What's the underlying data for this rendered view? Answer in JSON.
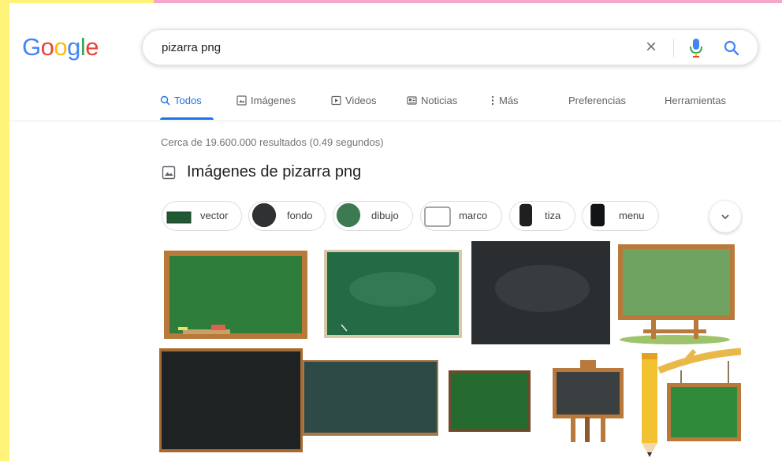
{
  "logo": {
    "letters": [
      "G",
      "o",
      "o",
      "g",
      "l",
      "e"
    ],
    "colors": [
      "#4285f4",
      "#ea4335",
      "#fbbc05",
      "#4285f4",
      "#34a853",
      "#ea4335"
    ]
  },
  "search": {
    "query": "pizarra png",
    "clear_glyph": "×"
  },
  "tabs": [
    {
      "label": "Todos",
      "icon": "search-icon"
    },
    {
      "label": "Imágenes",
      "icon": "image-icon"
    },
    {
      "label": "Videos",
      "icon": "video-icon"
    },
    {
      "label": "Noticias",
      "icon": "news-icon"
    },
    {
      "label": "Más",
      "icon": "more-vertical-icon"
    },
    {
      "label": "Preferencias"
    },
    {
      "label": "Herramientas"
    }
  ],
  "result_stats": "Cerca de 19.600.000 resultados (0.49 segundos)",
  "images_heading": "Imágenes de pizarra png",
  "chips": [
    {
      "label": "vector"
    },
    {
      "label": "fondo"
    },
    {
      "label": "dibujo"
    },
    {
      "label": "marco"
    },
    {
      "label": "tiza"
    },
    {
      "label": "menu"
    }
  ],
  "colors": {
    "accent": "#1a73e8",
    "board_green": "#2f7d3a",
    "board_black": "#2b2e31",
    "wood": "#b9793b",
    "frame_yellow": "#fff37a",
    "frame_pink": "#f4a7c8"
  }
}
